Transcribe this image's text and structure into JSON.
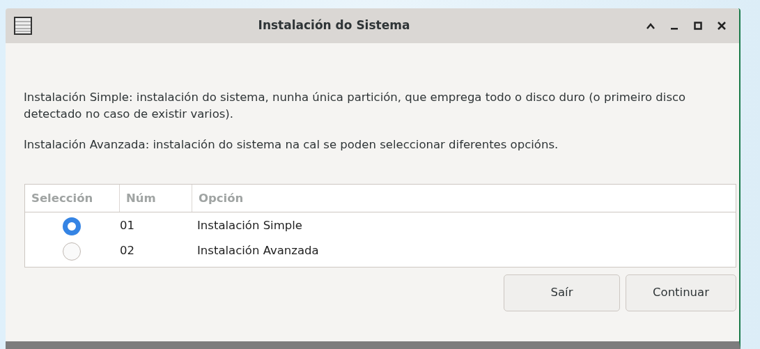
{
  "window": {
    "title": "Instalación do Sistema"
  },
  "paragraphs": [
    "Instalación Simple: instalación do sistema, nunha única partición, que emprega todo o disco duro (o primeiro disco detectado no caso de existir varios).",
    "Instalación Avanzada: instalación do sistema na cal se poden seleccionar diferentes opcións."
  ],
  "table": {
    "columns": [
      "Selección",
      "Núm",
      "Opción"
    ],
    "rows": [
      {
        "selected": true,
        "num": "01",
        "option": "Instalación Simple"
      },
      {
        "selected": false,
        "num": "02",
        "option": "Instalación Avanzada"
      }
    ]
  },
  "buttons": [
    "Saír",
    "Continuar"
  ]
}
